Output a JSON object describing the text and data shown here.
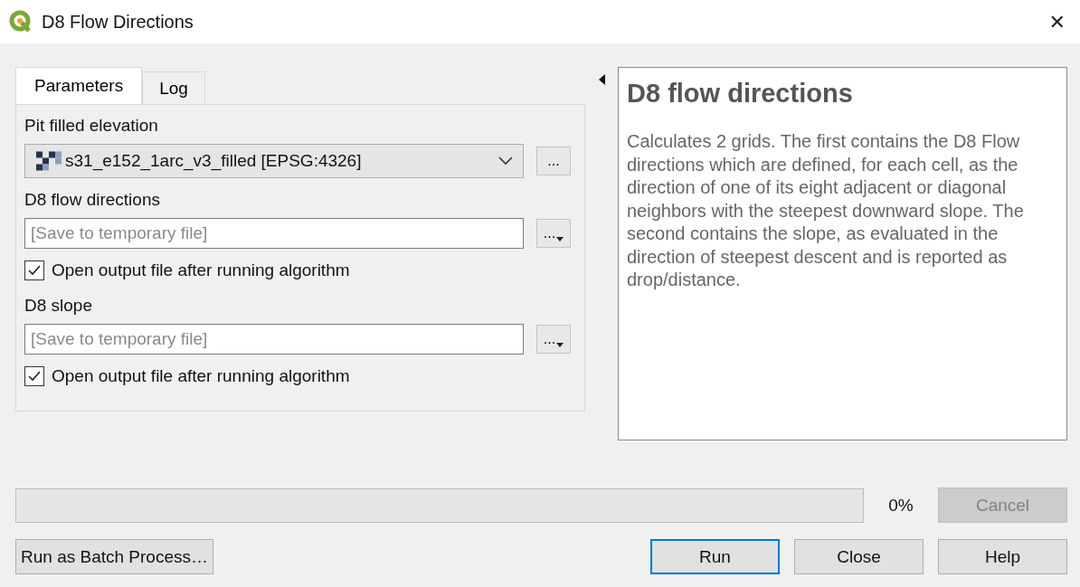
{
  "window": {
    "title": "D8 Flow Directions",
    "close": "✕"
  },
  "tabs": [
    {
      "label": "Parameters",
      "selected": true
    },
    {
      "label": "Log",
      "selected": false
    }
  ],
  "parameters": [
    {
      "kind": "label",
      "text": "Pit filled elevation"
    },
    {
      "kind": "combo",
      "value": "s31_e152_1arc_v3_filled [EPSG:4326]",
      "button": "..."
    },
    {
      "kind": "label",
      "text": "D8 flow directions"
    },
    {
      "kind": "output",
      "placeholder": "[Save to temporary file]",
      "button": "..."
    },
    {
      "kind": "checkbox",
      "text": "Open output file after running algorithm",
      "checked": true
    },
    {
      "kind": "label",
      "text": "D8 slope"
    },
    {
      "kind": "output",
      "placeholder": "[Save to temporary file]",
      "button": "..."
    },
    {
      "kind": "checkbox",
      "text": "Open output file after running algorithm",
      "checked": true
    }
  ],
  "help": {
    "title": "D8 flow directions",
    "body": "Calculates 2 grids. The first contains the D8 Flow directions which are defined, for each cell, as the direction of one of its eight adjacent or diagonal neighbors with the steepest downward slope. The second contains the slope, as evaluated in the direction of steepest descent and is reported as drop/distance."
  },
  "progress": {
    "level": 0,
    "reading": "0%",
    "cancel": {
      "label": "Cancel",
      "disabled": true
    }
  },
  "buttons": [
    {
      "label": "Run as Batch Process…",
      "default": false
    },
    {
      "label": "Run",
      "default": true
    },
    {
      "label": "Close",
      "default": false
    },
    {
      "label": "Help",
      "default": false
    }
  ]
}
